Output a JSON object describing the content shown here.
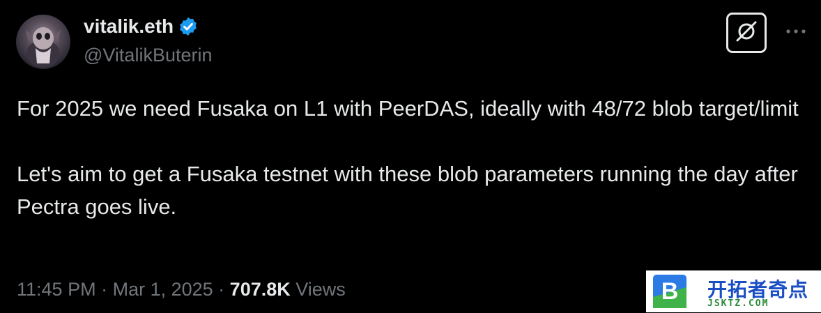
{
  "author": {
    "display_name": "vitalik.eth",
    "handle": "@VitalikButerin",
    "verified": true,
    "avatar_icon": "avatar"
  },
  "actions": {
    "grok_icon": "grok-icon",
    "more_icon": "more-icon"
  },
  "tweet": {
    "paragraphs": [
      "For 2025 we need Fusaka on L1 with PeerDAS, ideally with 48/72 blob target/limit",
      "Let's aim to get a Fusaka testnet with these blob parameters running the day after Pectra goes live."
    ]
  },
  "meta": {
    "time": "11:45 PM",
    "separator": " · ",
    "date": "Mar 1, 2025",
    "views_count": "707.8K",
    "views_label": "Views"
  },
  "watermark": {
    "title": "开拓者奇点",
    "url": "JSKTZ.COM"
  },
  "colors": {
    "background": "#000000",
    "text": "#e7e9ea",
    "secondary": "#71767b",
    "verified": "#1d9bf0"
  }
}
